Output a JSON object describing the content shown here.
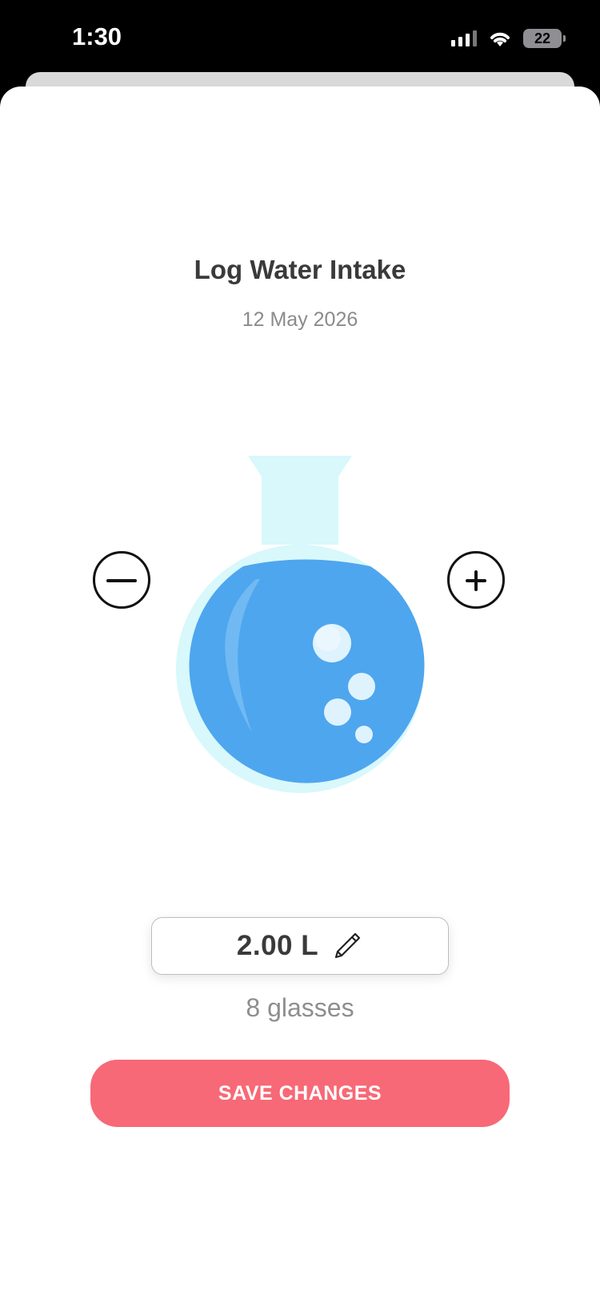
{
  "status_bar": {
    "time": "1:30",
    "battery": "22"
  },
  "screen": {
    "title": "Log Water Intake",
    "date": "12 May 2026",
    "decrease_icon": "minus-circle-icon",
    "increase_icon": "plus-circle-icon",
    "amount": "2.00 L",
    "edit_icon": "pencil-icon",
    "glasses": "8 glasses",
    "save_label": "SAVE CHANGES"
  },
  "colors": {
    "water": "#4ea6ee",
    "glass": "#d8f8fb",
    "accent": "#f76976"
  }
}
